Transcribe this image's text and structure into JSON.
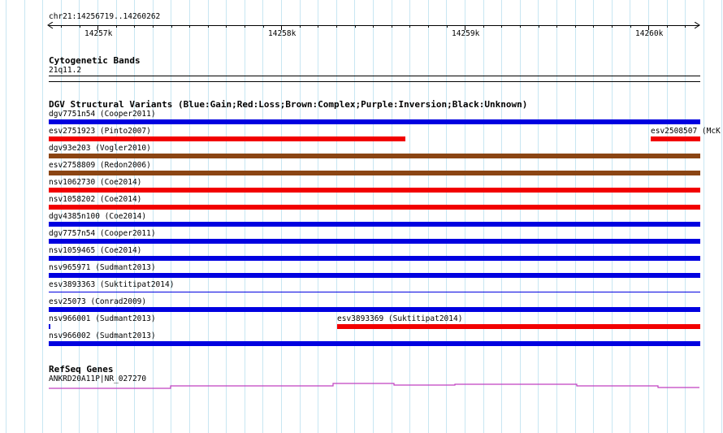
{
  "ruler": {
    "location": "chr21:14256719..14260262",
    "ticks": [
      {
        "label": "14257k"
      },
      {
        "label": "14258k"
      },
      {
        "label": "14259k"
      },
      {
        "label": "14260k"
      }
    ]
  },
  "cyto": {
    "title": "Cytogenetic Bands",
    "band": "21q11.2"
  },
  "dgv": {
    "title": "DGV Structural Variants (Blue:Gain;Red:Loss;Brown:Complex;Purple:Inversion;Black:Unknown)",
    "colors": {
      "gain": "#0000e0",
      "loss": "#f20000",
      "complex": "#8b4513"
    },
    "variants": [
      {
        "label": "dgv7751n54 (Cooper2011)",
        "type": "gain"
      },
      {
        "label": "esv2751923 (Pinto2007)",
        "type": "loss"
      },
      {
        "label": "esv2508507 (McK",
        "type": "loss"
      },
      {
        "label": "dgv93e203 (Vogler2010)",
        "type": "complex"
      },
      {
        "label": "esv2758809 (Redon2006)",
        "type": "complex"
      },
      {
        "label": "nsv1062730 (Coe2014)",
        "type": "loss"
      },
      {
        "label": "nsv1058202 (Coe2014)",
        "type": "loss"
      },
      {
        "label": "dgv4385n100 (Coe2014)",
        "type": "gain"
      },
      {
        "label": "dgv7757n54 (Cooper2011)",
        "type": "gain"
      },
      {
        "label": "nsv1059465 (Coe2014)",
        "type": "gain"
      },
      {
        "label": "nsv965971 (Sudmant2013)",
        "type": "gain"
      },
      {
        "label": "esv3893363 (Suktitipat2014)",
        "type": "gain"
      },
      {
        "label": "esv25073 (Conrad2009)",
        "type": "gain"
      },
      {
        "label": "nsv966001 (Sudmant2013)",
        "type": "gain"
      },
      {
        "label": "esv3893369 (Suktitipat2014)",
        "type": "loss"
      },
      {
        "label": "nsv966002 (Sudmant2013)",
        "type": "gain"
      }
    ]
  },
  "refseq": {
    "title": "RefSeq Genes",
    "gene_label": "ANKRD20A11P|NR_027270",
    "color": "#c040c0"
  }
}
